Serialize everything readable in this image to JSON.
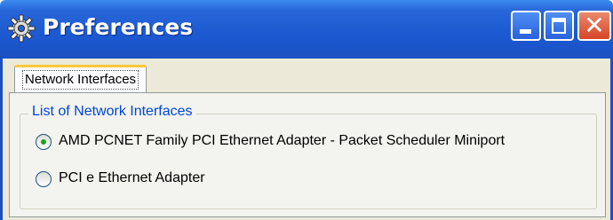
{
  "window": {
    "title": "Preferences",
    "icon": "gear-icon",
    "controls": [
      "minimize",
      "maximize",
      "close"
    ],
    "close_glyph": "✕"
  },
  "tabs": [
    {
      "label": "Network Interfaces",
      "selected": true
    }
  ],
  "group": {
    "legend": "List of Network Interfaces",
    "options": [
      {
        "label": "AMD PCNET Family PCI Ethernet Adapter - Packet Scheduler Miniport",
        "checked": true
      },
      {
        "label": "PCI e  Ethernet Adapter",
        "checked": false
      }
    ]
  },
  "colors": {
    "titlebar": "#1c59d1",
    "close_button": "#d8452a",
    "legend_text": "#0046d5",
    "radio_dot": "#21a121",
    "client_background": "#ece9d8"
  }
}
